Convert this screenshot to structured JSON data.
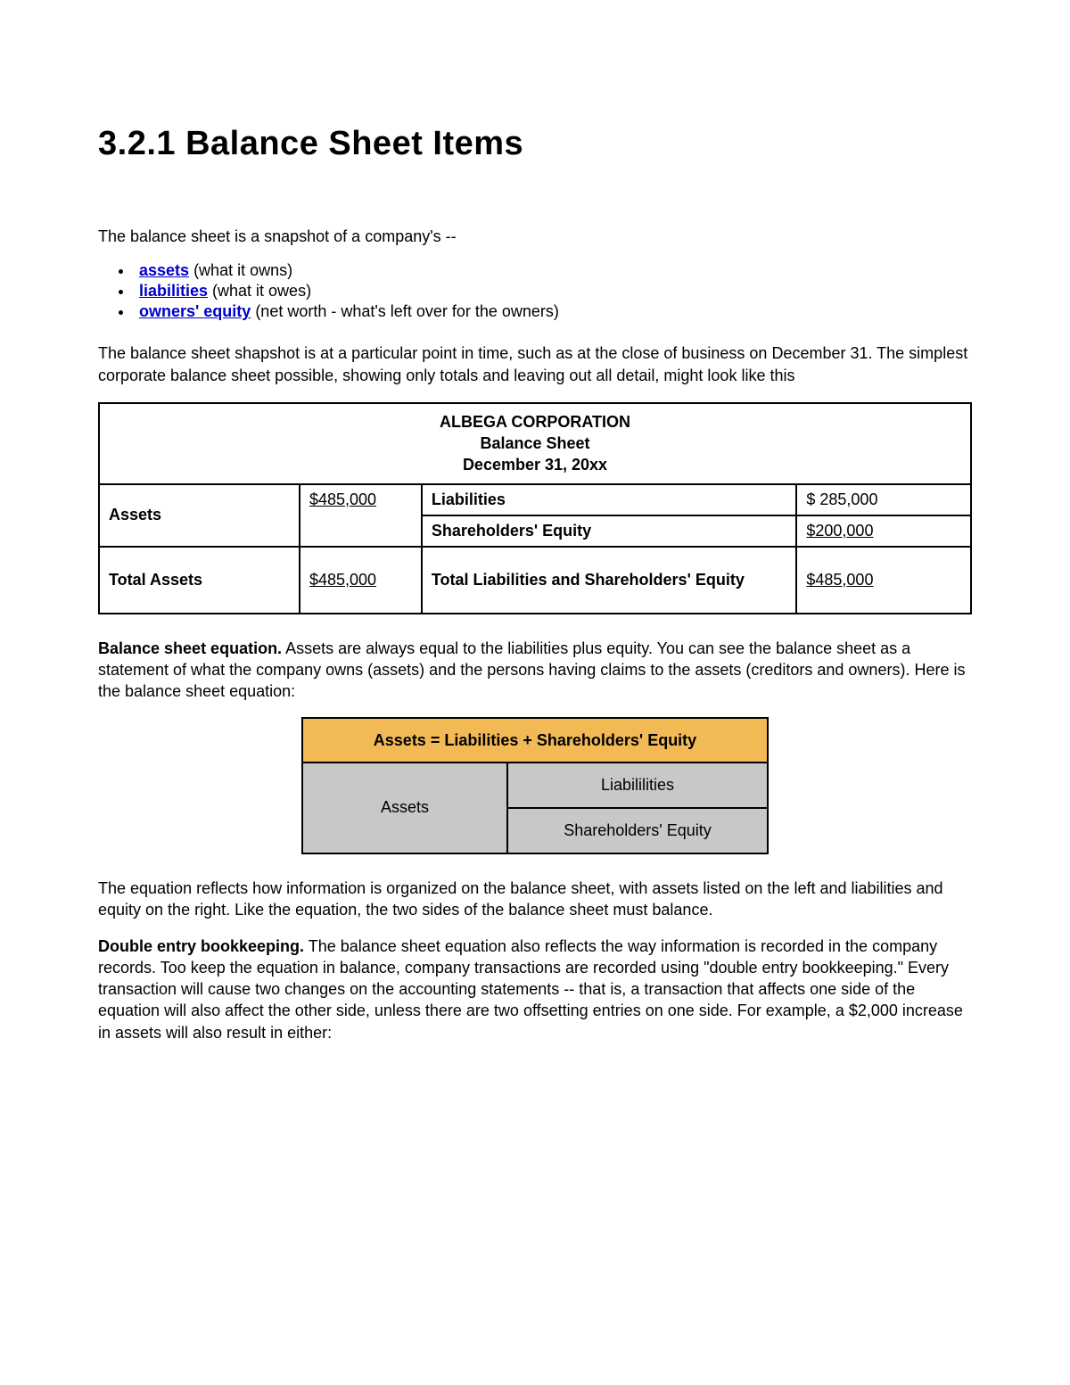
{
  "title": "3.2.1 Balance Sheet Items",
  "intro": "The balance sheet is a snapshot of a company's --",
  "bullets": [
    {
      "link": "assets",
      "after": " (what it owns)"
    },
    {
      "link": "liabilities",
      "after": " (what it owes)"
    },
    {
      "link": "owners' equity",
      "after": " (net worth - what's left over for the owners)"
    }
  ],
  "para2": "The balance sheet shapshot is at a particular point in time, such as at the close of business on December 31. The simplest corporate balance sheet possible, showing only totals and leaving out all detail, might look like this",
  "balance": {
    "corp": "ALBEGA CORPORATION",
    "subtitle": "Balance Sheet",
    "date": "December 31, 20xx",
    "assets_label": "Assets",
    "assets_amt": "$485,000",
    "liab_label": "Liabilities",
    "liab_amt": "$ 285,000",
    "se_label": "Shareholders' Equity",
    "se_amt": "$200,000",
    "total_assets_label": "Total Assets",
    "total_assets_amt": "$485,000",
    "total_lse_label": "Total Liabilities and Shareholders' Equity",
    "total_lse_amt": "$485,000"
  },
  "eqn_para_lead": "Balance sheet equation.",
  "eqn_para_body": " Assets are always equal to the liabilities plus equity. You can see the balance sheet as a statement of what the company owns (assets) and the persons having claims to the assets (creditors and owners). Here is the balance sheet equation:",
  "eqn": {
    "header": "Assets = Liabilities + Shareholders' Equity",
    "assets": "Assets",
    "liab": "Liabililities",
    "se": "Shareholders' Equity"
  },
  "reflect_para": "The equation reflects how information is organized on the balance sheet, with assets listed on the left and liabilities and equity on the right. Like the equation, the two sides of the balance sheet must balance.",
  "double_lead": "Double entry bookkeeping.",
  "double_body": " The balance sheet equation also reflects the way information is recorded in the company records. Too keep the equation in balance, company transactions are recorded using \"double entry bookkeeping.\" Every transaction will cause two changes on the accounting statements -- that is, a transaction that affects one side of the equation will also affect the other side, unless there are two offsetting entries on one side. For example, a $2,000 increase in assets will also result in either:"
}
